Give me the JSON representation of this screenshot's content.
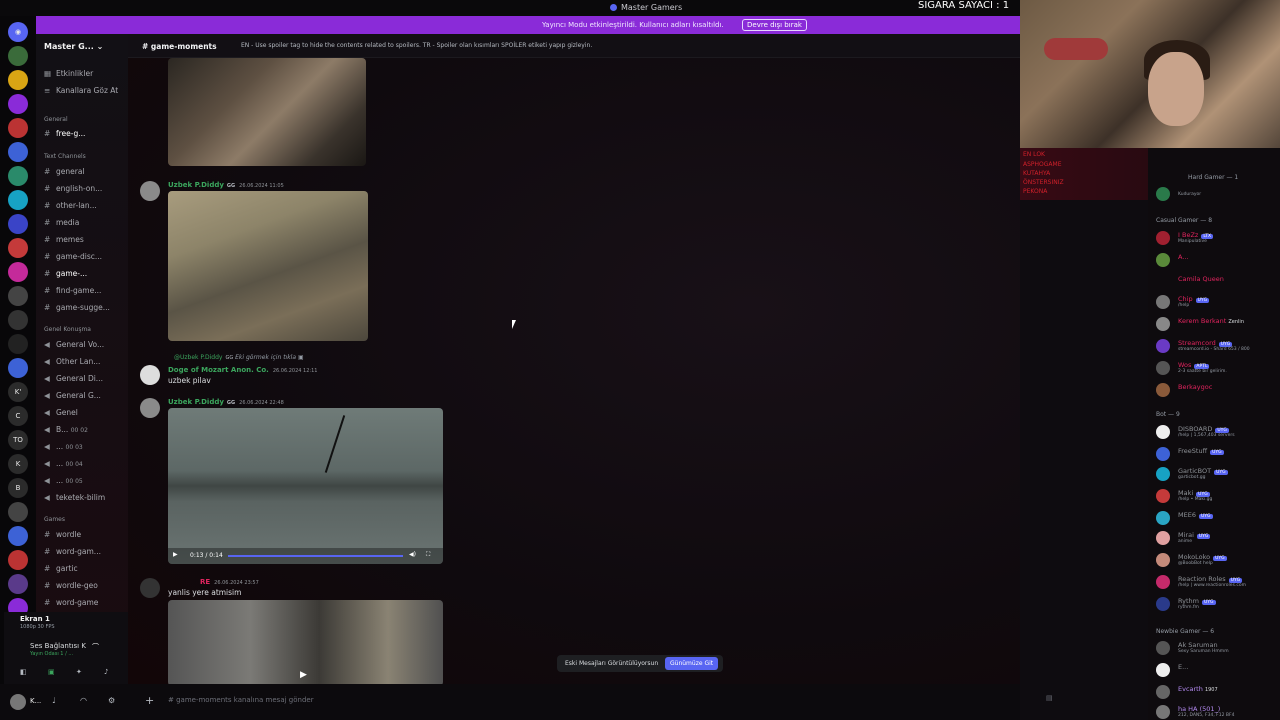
{
  "window": {
    "title": "Master Gamers"
  },
  "banner": {
    "text": "Yayıncı Modu etkinleştirildi. Kullanıcı adları kısaltıldı.",
    "button": "Devre dışı bırak"
  },
  "stream_overlay": {
    "counter": "SİGARA SAYACI : 1"
  },
  "server": {
    "name": "Master G..."
  },
  "sidebar": {
    "top_items": [
      {
        "label": "Etkinlikler"
      },
      {
        "label": "Kanallara Göz At"
      }
    ],
    "categories": {
      "general": "General",
      "text": "Text Channels",
      "voice": "Genel Konuşma",
      "games": "Games"
    },
    "general_channels": [
      {
        "label": "free-g...",
        "badge": "1"
      }
    ],
    "text_channels": [
      {
        "label": "general"
      },
      {
        "label": "english-on..."
      },
      {
        "label": "other-lan..."
      },
      {
        "label": "media"
      },
      {
        "label": "memes"
      },
      {
        "label": "game-disc..."
      },
      {
        "label": "game-..."
      },
      {
        "label": "find-game..."
      },
      {
        "label": "game-sugge..."
      }
    ],
    "voice_channels": [
      {
        "label": "General Vo..."
      },
      {
        "label": "Other Lan..."
      },
      {
        "label": "General Di..."
      },
      {
        "label": "General G..."
      },
      {
        "label": "Genel"
      },
      {
        "label": "B...",
        "count": "00 02"
      },
      {
        "label": "...",
        "count": "00 03"
      },
      {
        "label": "...",
        "count": "00 04"
      },
      {
        "label": "...",
        "count": "00 05"
      },
      {
        "label": "teketek-bilim"
      }
    ],
    "game_channels": [
      {
        "label": "wordle"
      },
      {
        "label": "word-gam..."
      },
      {
        "label": "gartic"
      },
      {
        "label": "wordle-geo"
      },
      {
        "label": "word-game"
      }
    ]
  },
  "voice_panel": {
    "title": "Ekran 1",
    "sub": "1080p 30 FPS",
    "conn": "Ses Bağlantısı K",
    "room": "Yayın Odası 1 / ..."
  },
  "user": {
    "name": "K..."
  },
  "channel": {
    "name": "game-moments",
    "topic": "EN - Use spoiler tag to hide the contents related to spoilers. TR - Spoiler olan kısımları SPOİLER etiketi yapıp gizleyin.",
    "input_placeholder": "game-moments kanalına mesaj gönder"
  },
  "messages": [
    {
      "author": "Uzbek P.Diddy",
      "tag": "GG",
      "time": "26.06.2024 11:05"
    },
    {
      "reply_to": "@Uzbek P.Diddy",
      "reply_tag": "GG",
      "reply_text": "Eki görmek için tıkla",
      "author": "Doge of Mozart Anon. Co.",
      "time": "26.06.2024 12:11",
      "text": "uzbek pilav"
    },
    {
      "author": "Uzbek P.Diddy",
      "tag": "GG",
      "time": "26.06.2024 22:48",
      "video_time": "0:13 / 0:14"
    },
    {
      "author": "RE",
      "time": "26.06.2024 23:57",
      "text": "yanlis yere atmisim"
    }
  ],
  "toast": {
    "text": "Eski Mesajları Görüntülüyorsun",
    "button": "Günümüze Git"
  },
  "overlay_labels": [
    "EN LOK",
    "ASPHOGAME",
    "KUTAHYA",
    "ÖNSTERSINIZ",
    "PEKONA"
  ],
  "members": {
    "hard_gamer": "Hard Gamer — 1",
    "hard_members": [
      {
        "name": "",
        "status": "Kudurayor"
      }
    ],
    "casual": "Casual Gamer — 8",
    "casual_members": [
      {
        "name": "I BeZz",
        "tag": "LTX",
        "status": "Manipulative",
        "color": "#e0245e"
      },
      {
        "name": "A...",
        "status": "",
        "color": "#e0245e"
      },
      {
        "name": "Camila Queen",
        "status": "",
        "color": "#e0245e"
      },
      {
        "name": "Chip",
        "tag": "UYG",
        "status": "/help",
        "color": "#e0245e"
      },
      {
        "name": "Kerem Berkant",
        "status": "Zenlin",
        "color": "#e0245e"
      },
      {
        "name": "Streamcord",
        "tag": "UYG",
        "status": "streamcord.io - Shard 653 / 800",
        "color": "#e0245e"
      },
      {
        "name": "Wos",
        "tag": "APTL",
        "status": "2-3 saatte bir gelirim.",
        "color": "#e0245e"
      },
      {
        "name": "Berkaygoc",
        "status": "",
        "color": "#e0245e"
      }
    ],
    "bot": "Bot — 9",
    "bots": [
      {
        "name": "DISBOARD",
        "tag": "UYG",
        "status": "/help | 1,567,403 servers"
      },
      {
        "name": "FreeStuff",
        "tag": "UYG",
        "status": ""
      },
      {
        "name": "GarticBOT",
        "tag": "UYG",
        "status": "garticbot.gg"
      },
      {
        "name": "Maki",
        "tag": "UYG",
        "status": "/help • Maki.gg"
      },
      {
        "name": "MEE6",
        "tag": "UYG",
        "status": ""
      },
      {
        "name": "Mirai",
        "tag": "UYG",
        "status": "anime"
      },
      {
        "name": "MokoLoko",
        "tag": "UYG",
        "status": "@BoobBot help"
      },
      {
        "name": "Reaction Roles",
        "tag": "UYG",
        "status": "/help | www.reactionroles.com"
      },
      {
        "name": "Rythm",
        "tag": "UYG",
        "status": "rythm.fm"
      }
    ],
    "newbie": "Newbie Gamer — 6",
    "newbie_members": [
      {
        "name": "Ak Saruman",
        "status": "Sexy Saruman Hmmm"
      },
      {
        "name": "E...",
        "status": ""
      },
      {
        "name": "Evcarth",
        "status": "1907"
      },
      {
        "name": "ha HA (501_)",
        "status": "212, DAN5, F34, F12 BF4"
      }
    ]
  },
  "colors": {
    "accent": "#5865f2",
    "banner": "#8a2bd8",
    "online": "#3ba55d"
  }
}
